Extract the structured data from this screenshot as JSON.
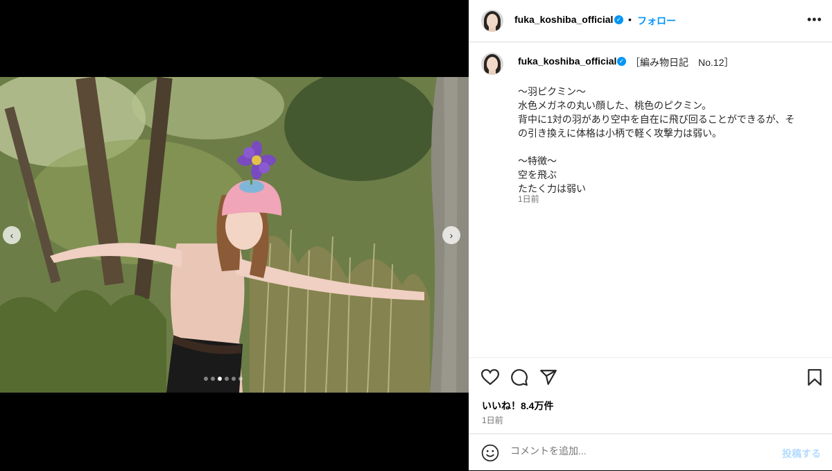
{
  "post": {
    "username": "fuka_koshiba_official",
    "follow_label": "フォロー",
    "bullet": "•",
    "verified_glyph": "✓",
    "more_label": "•••",
    "caption_title": "［編み物日記　No.12］",
    "caption_lines": [
      "〜羽ピクミン〜",
      "水色メガネの丸い顔した、桃色のピクミン。",
      "背中に1対の羽があり空中を自在に飛び回ることができるが、そ",
      "の引き換えに体格は小柄で軽く攻撃力は弱い。",
      "",
      "〜特徴〜",
      "空を飛ぶ",
      "たたく力は弱い"
    ],
    "caption_time": "1日前",
    "likes": "いいね！8.4万件",
    "date": "1日前"
  },
  "comment": {
    "placeholder": "コメントを追加...",
    "post_label": "投稿する"
  },
  "carousel": {
    "prev_glyph": "‹",
    "next_glyph": "›",
    "dot_count": 6,
    "active_index": 2
  },
  "colors": {
    "accent": "#0095f6",
    "post_disabled": "#b3dbff",
    "muted": "#737373"
  },
  "icons": [
    "heart-icon",
    "comment-icon",
    "share-icon",
    "bookmark-icon",
    "emoji-icon",
    "more-icon",
    "verified-icon",
    "chevron-left-icon",
    "chevron-right-icon"
  ]
}
